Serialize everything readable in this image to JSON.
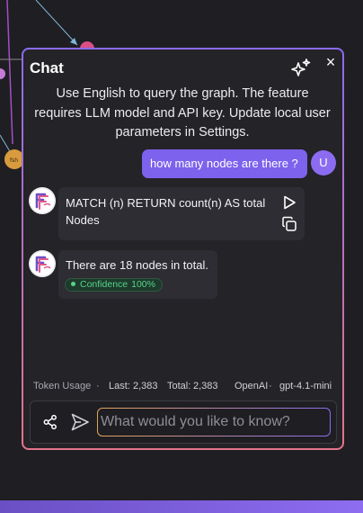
{
  "graph": {
    "node_label": "fsh"
  },
  "chat": {
    "title": "Chat",
    "intro": "Use English to query the graph. The feature requires LLM model and API key. Update local user parameters in Settings.",
    "close_glyph": "×",
    "header_icons": [
      "sparkles-icon",
      "close-icon"
    ],
    "messages": {
      "user": {
        "text": "how many nodes are there ?",
        "avatar_initial": "U"
      },
      "query": {
        "text": "MATCH (n) RETURN count(n) AS total Nodes",
        "icons": [
          "play-icon",
          "copy-icon"
        ]
      },
      "answer": {
        "text": "There are 18 nodes in total.",
        "confidence_label": "Confidence",
        "confidence_value": "100%"
      }
    },
    "token_usage": {
      "label": "Token Usage",
      "separator": "·",
      "last_label": "Last:",
      "last_value": "2,383",
      "total_label": "Total:",
      "total_value": "2,383",
      "provider": "OpenAI",
      "model": "gpt-4.1-mini"
    },
    "input": {
      "placeholder": "What would you like to know?",
      "value": "",
      "icons": [
        "share-icon",
        "send-icon"
      ]
    }
  },
  "colors": {
    "accent": "#7c62ec",
    "panel_border_top": "#8a6cf0",
    "panel_border_bottom": "#e3748a",
    "confidence_green": "#56d38a"
  }
}
